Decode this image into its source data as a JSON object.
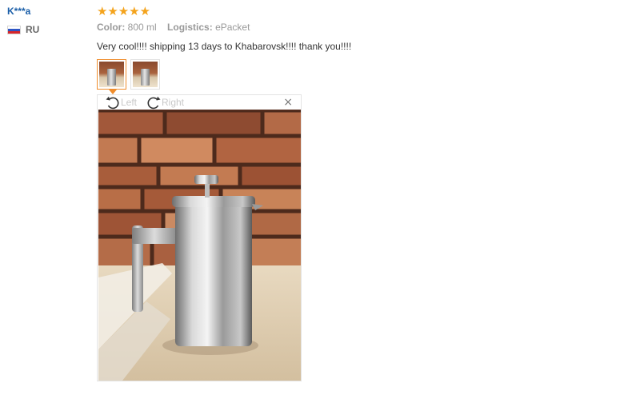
{
  "reviewer": {
    "name": "K***a",
    "country_code": "RU"
  },
  "review": {
    "rating": 5,
    "stars": [
      "★",
      "★",
      "★",
      "★",
      "★"
    ],
    "star_color": "#f4a31c",
    "color_label": "Color:",
    "color_value": "800 ml",
    "logistics_label": "Logistics:",
    "logistics_value": "ePacket",
    "text": "Very cool!!!! shipping 13 days to Khabarovsk!!!! thank you!!!!"
  },
  "viewer": {
    "rotate_left_label": "Left",
    "rotate_right_label": "Right",
    "close_glyph": "×",
    "active_border_color": "#f08d2c"
  }
}
